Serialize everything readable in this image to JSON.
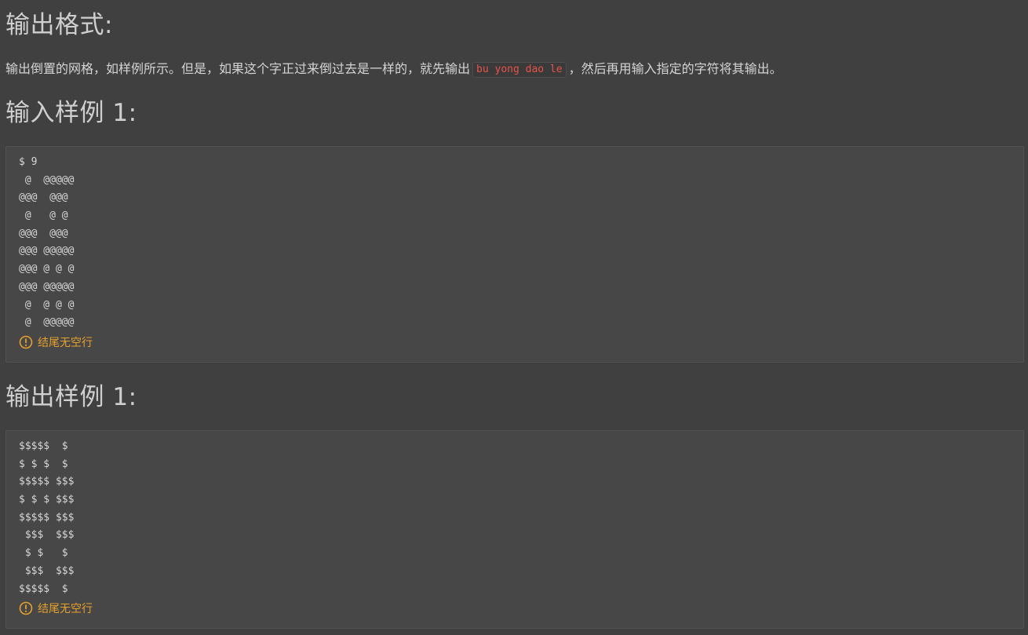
{
  "output_format": {
    "heading": "输出格式:",
    "text_before": "输出倒置的网格，如样例所示。但是，如果这个字正过来倒过去是一样的，就先输出",
    "code": "bu yong dao le",
    "text_after": "，然后再用输入指定的字符将其输出。"
  },
  "input_sample": {
    "heading": "输入样例 1:",
    "lines": [
      "$ 9",
      " @  @@@@@",
      "@@@  @@@",
      " @   @ @",
      "@@@  @@@",
      "@@@ @@@@@",
      "@@@ @ @ @",
      "@@@ @@@@@",
      " @  @ @ @",
      " @  @@@@@"
    ],
    "note": "结尾无空行"
  },
  "output_sample": {
    "heading": "输出样例 1:",
    "lines": [
      "$$$$$  $",
      "$ $ $  $",
      "$$$$$ $$$",
      "$ $ $ $$$",
      "$$$$$ $$$",
      " $$$  $$$",
      " $ $   $",
      " $$$  $$$",
      "$$$$$  $"
    ],
    "note": "结尾无空行"
  },
  "icons": {
    "note_icon": "warning-circle-icon"
  },
  "colors": {
    "background": "#404040",
    "code_box": "#474747",
    "inline_code_text": "#e8534a",
    "note_text": "#e6a02c"
  }
}
